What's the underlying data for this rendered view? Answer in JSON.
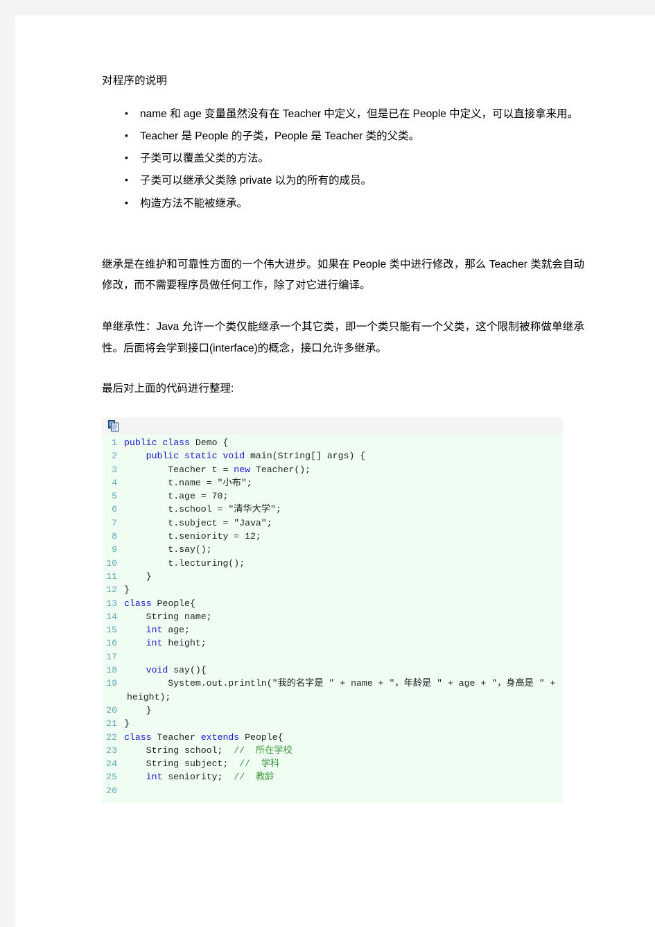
{
  "document": {
    "heading": "对程序的说明",
    "bullets": [
      "name 和 age 变量虽然没有在 Teacher 中定义，但是已在 People 中定义，可以直接拿来用。",
      "Teacher 是 People 的子类，People 是 Teacher 类的父类。",
      "子类可以覆盖父类的方法。",
      "子类可以继承父类除 private 以为的所有的成员。",
      "构造方法不能被继承。"
    ],
    "paragraphs": [
      "继承是在维护和可靠性方面的一个伟大进步。如果在 People 类中进行修改，那么 Teacher 类就会自动修改，而不需要程序员做任何工作，除了对它进行编译。",
      "单继承性：Java 允许一个类仅能继承一个其它类，即一个类只能有一个父类，这个限制被称做单继承性。后面将会学到接口(interface)的概念，接口允许多继承。",
      "最后对上面的代码进行整理:"
    ]
  },
  "code_block": {
    "toolbar": {
      "copy_icon": "copy-to-clipboard-icon"
    },
    "language": "java",
    "lines": [
      {
        "n": "1",
        "tokens": [
          {
            "t": "kw",
            "v": "public class"
          },
          {
            "t": "pl",
            "v": " Demo {"
          }
        ]
      },
      {
        "n": "2",
        "tokens": [
          {
            "t": "pl",
            "v": "    "
          },
          {
            "t": "kw",
            "v": "public static void"
          },
          {
            "t": "pl",
            "v": " main(String[] args) {"
          }
        ]
      },
      {
        "n": "3",
        "tokens": [
          {
            "t": "pl",
            "v": "        Teacher t = "
          },
          {
            "t": "kw",
            "v": "new"
          },
          {
            "t": "pl",
            "v": " Teacher();"
          }
        ]
      },
      {
        "n": "4",
        "tokens": [
          {
            "t": "pl",
            "v": "        t.name = ″小布″;"
          }
        ]
      },
      {
        "n": "5",
        "tokens": [
          {
            "t": "pl",
            "v": "        t.age = 70;"
          }
        ]
      },
      {
        "n": "6",
        "tokens": [
          {
            "t": "pl",
            "v": "        t.school = ″清华大学″;"
          }
        ]
      },
      {
        "n": "7",
        "tokens": [
          {
            "t": "pl",
            "v": "        t.subject = ″Java″;"
          }
        ]
      },
      {
        "n": "8",
        "tokens": [
          {
            "t": "pl",
            "v": "        t.seniority = 12;"
          }
        ]
      },
      {
        "n": "9",
        "tokens": [
          {
            "t": "pl",
            "v": "        t.say();"
          }
        ]
      },
      {
        "n": "10",
        "tokens": [
          {
            "t": "pl",
            "v": "        t.lecturing();"
          }
        ]
      },
      {
        "n": "11",
        "tokens": [
          {
            "t": "pl",
            "v": "    }"
          }
        ]
      },
      {
        "n": "12",
        "tokens": [
          {
            "t": "pl",
            "v": "}"
          }
        ]
      },
      {
        "n": "13",
        "tokens": [
          {
            "t": "kw",
            "v": "class"
          },
          {
            "t": "pl",
            "v": " People{"
          }
        ]
      },
      {
        "n": "14",
        "tokens": [
          {
            "t": "pl",
            "v": "    String name;"
          }
        ]
      },
      {
        "n": "15",
        "tokens": [
          {
            "t": "pl",
            "v": "    "
          },
          {
            "t": "kw",
            "v": "int"
          },
          {
            "t": "pl",
            "v": " age;"
          }
        ]
      },
      {
        "n": "16",
        "tokens": [
          {
            "t": "pl",
            "v": "    "
          },
          {
            "t": "kw",
            "v": "int"
          },
          {
            "t": "pl",
            "v": " height;"
          }
        ]
      },
      {
        "n": "17",
        "tokens": [
          {
            "t": "pl",
            "v": ""
          }
        ]
      },
      {
        "n": "18",
        "tokens": [
          {
            "t": "pl",
            "v": "    "
          },
          {
            "t": "kw",
            "v": "void"
          },
          {
            "t": "pl",
            "v": " say(){"
          }
        ]
      },
      {
        "n": "19",
        "tokens": [
          {
            "t": "pl",
            "v": "        System.out.println(″我的名字是 ″ + name + ″，年龄是 ″ + age + ″，身高是 ″ + height);"
          }
        ]
      },
      {
        "n": "20",
        "tokens": [
          {
            "t": "pl",
            "v": "    }"
          }
        ]
      },
      {
        "n": "21",
        "tokens": [
          {
            "t": "pl",
            "v": "}"
          }
        ]
      },
      {
        "n": "22",
        "tokens": [
          {
            "t": "kw",
            "v": "class"
          },
          {
            "t": "pl",
            "v": " Teacher "
          },
          {
            "t": "kw",
            "v": "extends"
          },
          {
            "t": "pl",
            "v": " People{"
          }
        ]
      },
      {
        "n": "23",
        "tokens": [
          {
            "t": "pl",
            "v": "    String school;  "
          },
          {
            "t": "cm",
            "v": "//  所在学校"
          }
        ]
      },
      {
        "n": "24",
        "tokens": [
          {
            "t": "pl",
            "v": "    String subject;  "
          },
          {
            "t": "cm",
            "v": "//  学科"
          }
        ]
      },
      {
        "n": "25",
        "tokens": [
          {
            "t": "pl",
            "v": "    "
          },
          {
            "t": "kw",
            "v": "int"
          },
          {
            "t": "pl",
            "v": " seniority;  "
          },
          {
            "t": "cm",
            "v": "//  教龄"
          }
        ]
      },
      {
        "n": "26",
        "tokens": [
          {
            "t": "pl",
            "v": ""
          }
        ]
      }
    ]
  },
  "colors": {
    "page_background": "#ffffff",
    "canvas_background": "#f4f4f4",
    "code_background": "#f0fdf3",
    "code_toolbar_background": "#f5f4f4",
    "keyword": "#1515cf",
    "comment": "#3d9a3d",
    "line_number": "#5fa8b8",
    "text": "#000000"
  }
}
